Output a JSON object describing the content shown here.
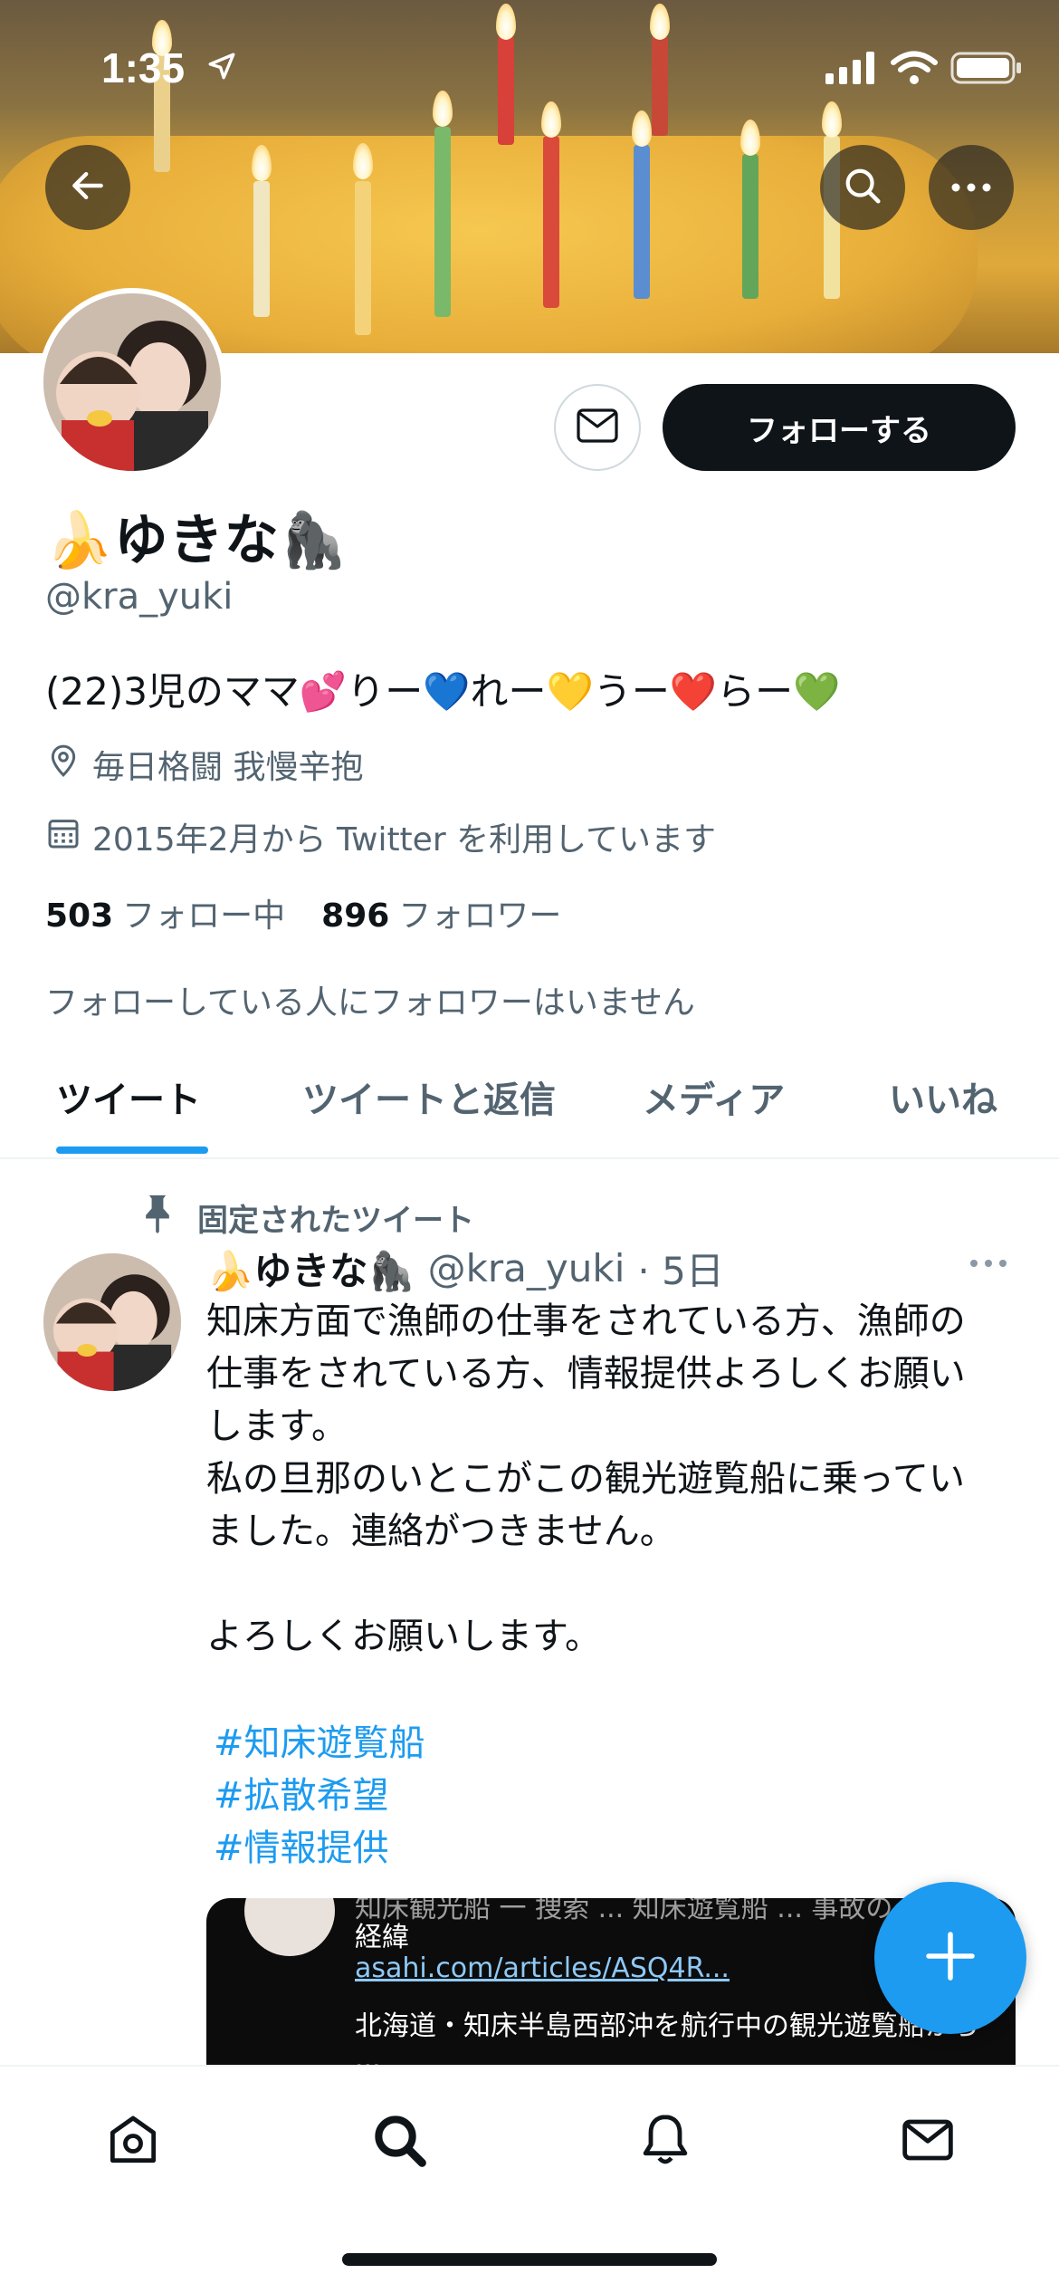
{
  "status_bar": {
    "time": "1:35"
  },
  "profile": {
    "name": "🍌ゆきな🦍",
    "handle": "@kra_yuki",
    "bio": "(22)3児のママ💕りー💙れー💛うー❤️らー💚",
    "location": "毎日格闘 我慢辛抱",
    "joined": "2015年2月から Twitter を利用しています",
    "following_count": "503",
    "following_label": "フォロー中",
    "followers_count": "896",
    "followers_label": "フォロワー",
    "mutual_note": "フォローしている人にフォロワーはいません"
  },
  "actions": {
    "follow_label": "フォローする"
  },
  "tabs": [
    {
      "label": "ツイート",
      "active": true
    },
    {
      "label": "ツイートと返信",
      "active": false
    },
    {
      "label": "メディア",
      "active": false
    },
    {
      "label": "いいね",
      "active": false
    }
  ],
  "pinned_tweet": {
    "pinned_label": "固定されたツイート",
    "author_name": "🍌ゆきな🦍",
    "author_handle": "@kra_yuki",
    "time": "· 5日",
    "body": "知床方面で漁師の仕事をされている方、漁師の\n仕事をされている方、情報提供よろしくお願い\nします。\n私の旦那のいとこがこの観光遊覧船に乗ってい\nました。連絡がつきません。\n\nよろしくお願いします。",
    "hashtags": [
      "#知床遊覧船",
      "#拡散希望",
      "#情報提供"
    ],
    "card": {
      "line1": "知床観光船 一 捜索 ... 知床遊覧船 ... 事故の",
      "line2": "経緯",
      "link": "asahi.com/articles/ASQ4R...",
      "line3": "北海道・知床半島西部沖を航行中の観光遊覧船から",
      "line4": "..."
    }
  },
  "colors": {
    "accent": "#1d9bf0",
    "text": "#0f1419",
    "secondary": "#536471"
  },
  "icons": [
    "back-arrow-icon",
    "search-icon",
    "more-icon",
    "mail-icon",
    "location-pin-icon",
    "calendar-icon",
    "pin-icon",
    "home-icon",
    "bell-icon",
    "compose-plus-icon"
  ]
}
